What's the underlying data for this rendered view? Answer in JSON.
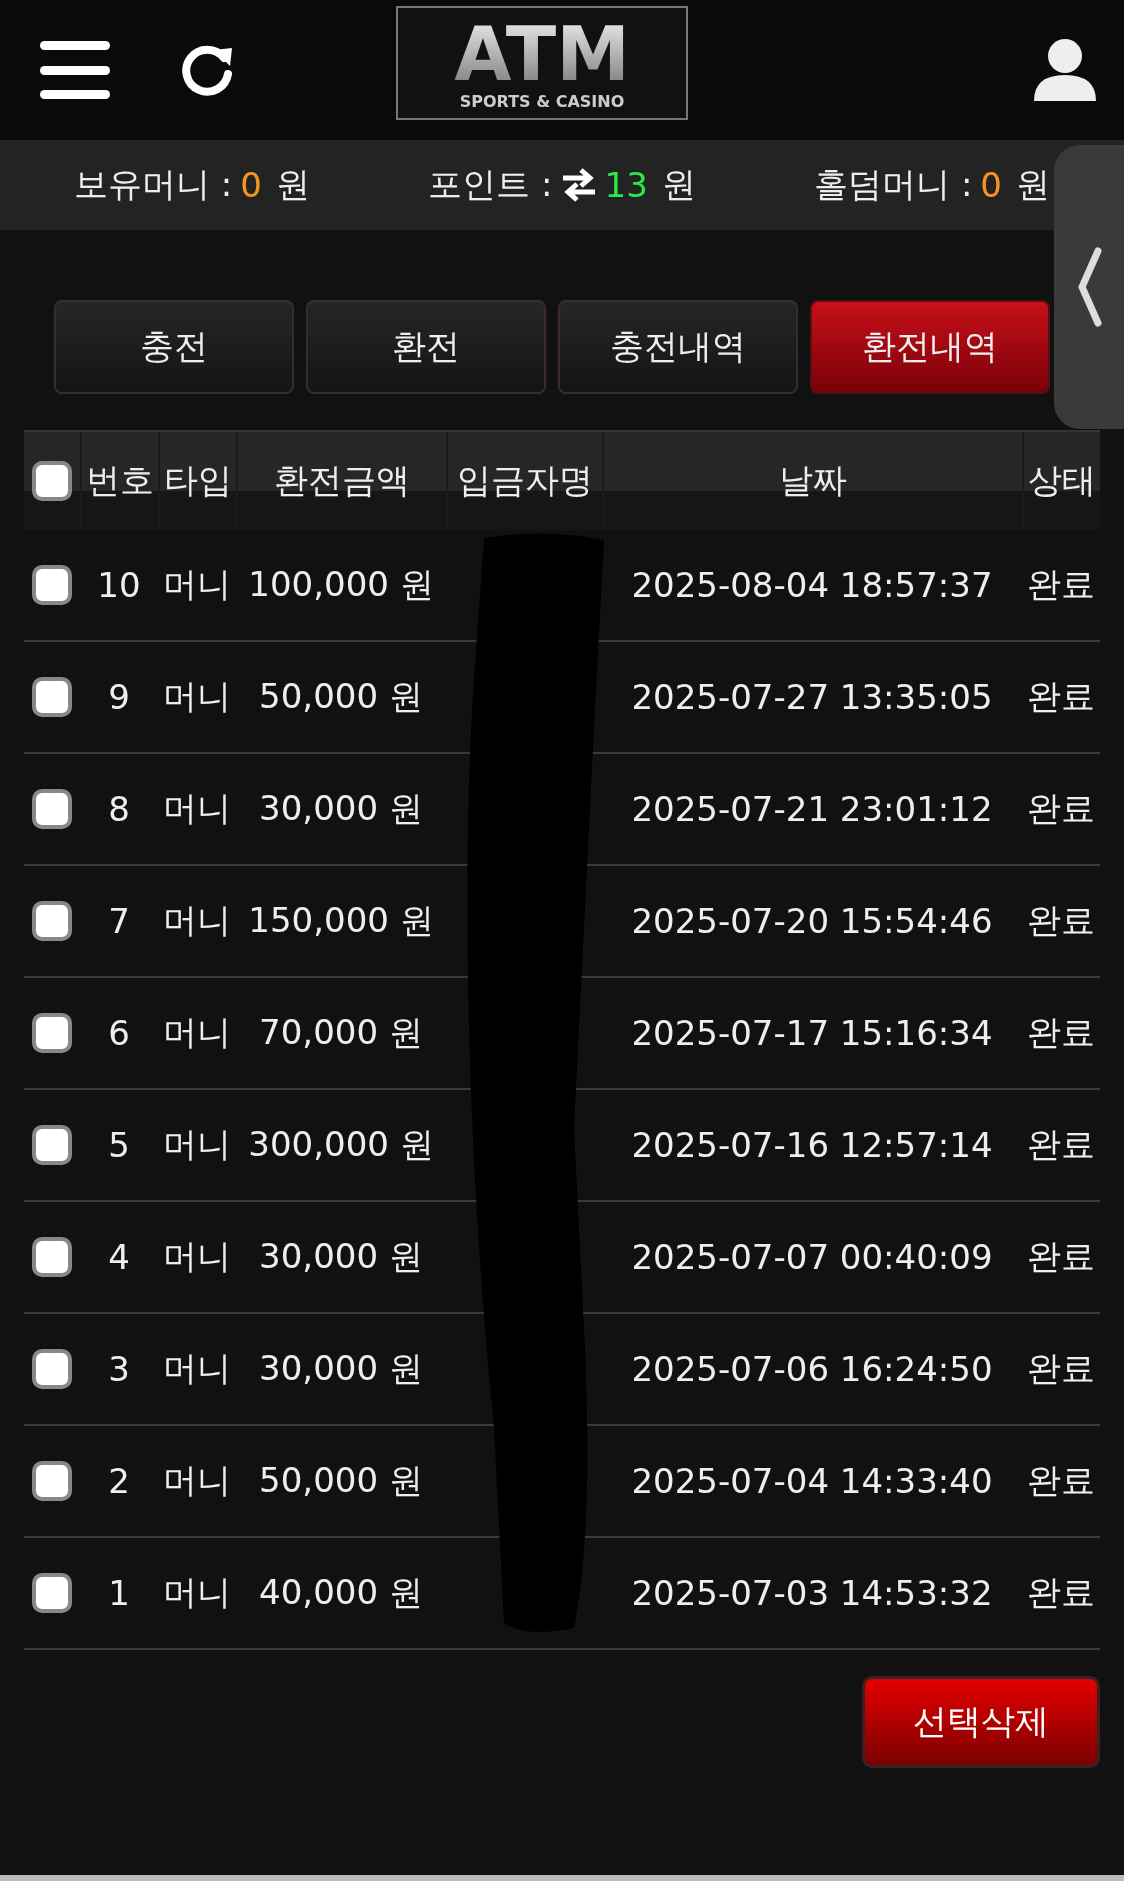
{
  "header": {
    "logo": {
      "title": "ATM",
      "subtitle": "SPORTS & CASINO"
    }
  },
  "balances": [
    {
      "label": "보유머니 :",
      "value": "0",
      "unit": "원",
      "kind": "money"
    },
    {
      "label": "포인트 :",
      "value": "13",
      "unit": "원",
      "kind": "point"
    },
    {
      "label": "홀덤머니 :",
      "value": "0",
      "unit": "원",
      "kind": "money"
    }
  ],
  "tabs": [
    {
      "label": "충전",
      "selected": false
    },
    {
      "label": "환전",
      "selected": false
    },
    {
      "label": "충전내역",
      "selected": false
    },
    {
      "label": "환전내역",
      "selected": true
    }
  ],
  "table": {
    "select_all_checked": false,
    "columns": [
      "번호",
      "타입",
      "환전금액",
      "입금자명",
      "날짜",
      "상태"
    ],
    "rows": [
      {
        "checked": false,
        "no": "10",
        "type": "머니",
        "amount": "100,000 원",
        "date": "2025-08-04 18:57:37",
        "status": "완료"
      },
      {
        "checked": false,
        "no": "9",
        "type": "머니",
        "amount": "50,000 원",
        "date": "2025-07-27 13:35:05",
        "status": "완료"
      },
      {
        "checked": false,
        "no": "8",
        "type": "머니",
        "amount": "30,000 원",
        "date": "2025-07-21 23:01:12",
        "status": "완료"
      },
      {
        "checked": false,
        "no": "7",
        "type": "머니",
        "amount": "150,000 원",
        "date": "2025-07-20 15:54:46",
        "status": "완료"
      },
      {
        "checked": false,
        "no": "6",
        "type": "머니",
        "amount": "70,000 원",
        "date": "2025-07-17 15:16:34",
        "status": "완료"
      },
      {
        "checked": false,
        "no": "5",
        "type": "머니",
        "amount": "300,000 원",
        "date": "2025-07-16 12:57:14",
        "status": "완료"
      },
      {
        "checked": false,
        "no": "4",
        "type": "머니",
        "amount": "30,000 원",
        "date": "2025-07-07 00:40:09",
        "status": "완료"
      },
      {
        "checked": false,
        "no": "3",
        "type": "머니",
        "amount": "30,000 원",
        "date": "2025-07-06 16:24:50",
        "status": "완료"
      },
      {
        "checked": false,
        "no": "2",
        "type": "머니",
        "amount": "50,000 원",
        "date": "2025-07-04 14:33:40",
        "status": "완료"
      },
      {
        "checked": false,
        "no": "1",
        "type": "머니",
        "amount": "40,000 원",
        "date": "2025-07-03 14:53:32",
        "status": "완료"
      }
    ]
  },
  "delete_button": "선택삭제"
}
